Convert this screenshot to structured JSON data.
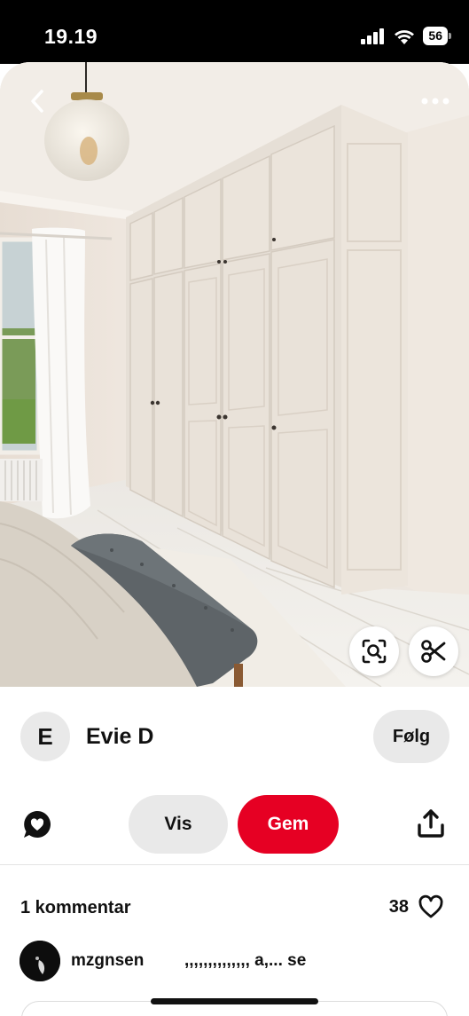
{
  "status_bar": {
    "time": "19.19",
    "battery": "56",
    "icons": [
      "cellular-signal-icon",
      "wifi-icon",
      "battery-icon"
    ]
  },
  "pin": {
    "image_description_icon": "bedroom-wardrobe-photo",
    "back_icon": "chevron-left-icon",
    "more_icon": "ellipsis-icon",
    "lens_icon": "visual-search-icon",
    "scissors_icon": "scissors-icon"
  },
  "creator": {
    "avatar_initial": "E",
    "name": "Evie D",
    "follow_label": "Følg"
  },
  "actions": {
    "comment_icon": "comment-bubble-icon",
    "vis_label": "Vis",
    "gem_label": "Gem",
    "share_icon": "share-upload-icon"
  },
  "comments": {
    "header": "1 kommentar",
    "like_count": "38",
    "like_icon": "heart-outline-icon",
    "items": [
      {
        "user": "mzgnsen",
        "text": ",,,,,,,,,,,,,, a,... se"
      }
    ]
  },
  "colors": {
    "primary_red": "#e60023",
    "button_gray": "#e9e9e9",
    "text": "#111111"
  }
}
